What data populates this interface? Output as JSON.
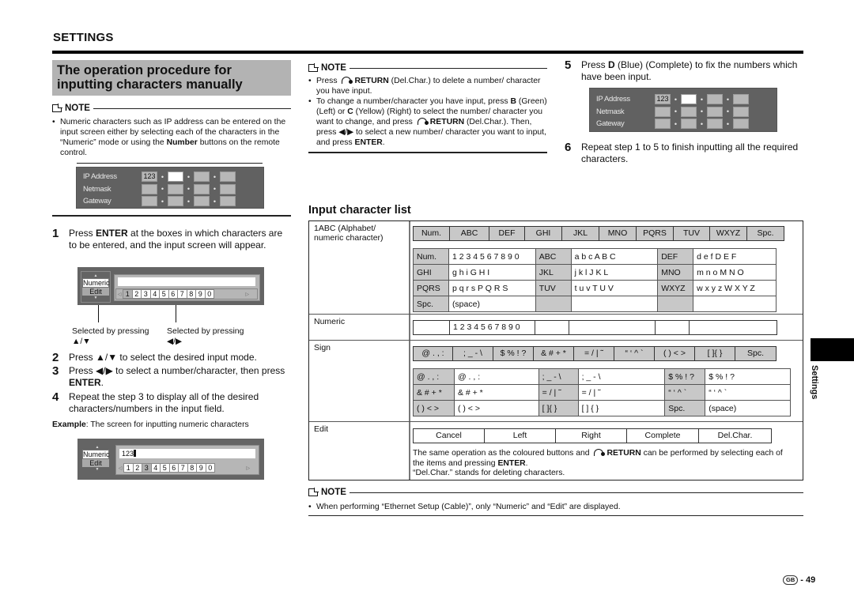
{
  "header": {
    "section": "SETTINGS"
  },
  "procedure": {
    "title_line1": "The operation procedure for",
    "title_line2": "inputting characters manually"
  },
  "note1": {
    "label": "NOTE",
    "text_a": "Numeric characters such as IP address can be entered on the input screen either by selecting each of the characters in the “Numeric” mode or using the ",
    "bold": "Number",
    "text_b": " buttons on the remote control."
  },
  "ip_panel": {
    "rows": [
      {
        "label": "IP Address",
        "first_value": "123"
      },
      {
        "label": "Netmask",
        "first_value": ""
      },
      {
        "label": "Gateway",
        "first_value": ""
      }
    ]
  },
  "step1": {
    "num": "1",
    "pre": "Press ",
    "bold": "ENTER",
    "post": " at the boxes in which characters are to be entered, and the input screen will appear."
  },
  "input_screen": {
    "modes": [
      "Numeric",
      "Edit"
    ],
    "digits": [
      "1",
      "2",
      "3",
      "4",
      "5",
      "6",
      "7",
      "8",
      "9",
      "0"
    ],
    "field_value": "",
    "caption_left": "Selected by pressing",
    "caption_left_keys": "▲/▼",
    "caption_right": "Selected by pressing",
    "caption_right_keys": "◀/▶"
  },
  "step2": {
    "num": "2",
    "text": "Press ▲/▼ to select the desired input mode."
  },
  "step3": {
    "num": "3",
    "pre": "Press ◀/▶ to select a number/character, then press ",
    "bold": "ENTER",
    "post": "."
  },
  "step4": {
    "num": "4",
    "text": "Repeat the step 3 to display all of the desired characters/numbers in the input field."
  },
  "example": {
    "bold": "Example",
    "text": ": The screen for inputting numeric characters",
    "field_value": "123",
    "highlighted_digit": "3"
  },
  "note2": {
    "label": "NOTE",
    "b1_pre": "Press ",
    "b1_return": "RETURN",
    "b1_post": " (Del.Char.) to delete a number/ character you have input.",
    "b2_a": "To change a number/character you have input, press ",
    "b2_B": "B",
    "b2_b": " (Green) (Left) or ",
    "b2_C": "C",
    "b2_c": " (Yellow) (Right) to select the number/ character you want to change, and press ",
    "b2_return": "RETURN",
    "b2_d": " (Del.Char.). Then, press ◀/▶ to select a new number/ character you want to input, and press ",
    "b2_enter": "ENTER",
    "b2_e": "."
  },
  "step5": {
    "num": "5",
    "pre": "Press ",
    "bold": "D",
    "post": " (Blue) (Complete) to fix the numbers which have been input."
  },
  "step6": {
    "num": "6",
    "text": "Repeat step 1 to 5 to finish inputting all the required characters."
  },
  "char_list": {
    "title": "Input character list",
    "alpha": {
      "label": "1ABC (Alphabet/ numeric character)",
      "tabs": [
        "Num.",
        "ABC",
        "DEF",
        "GHI",
        "JKL",
        "MNO",
        "PQRS",
        "TUV",
        "WXYZ",
        "Spc."
      ],
      "rows": [
        [
          [
            "Num.",
            "1 2 3 4 5 6 7 8 9 0"
          ],
          [
            "ABC",
            "a b c A B C"
          ],
          [
            "DEF",
            "d e f D E F"
          ]
        ],
        [
          [
            "GHI",
            "g h i G H I"
          ],
          [
            "JKL",
            "j k l J K L"
          ],
          [
            "MNO",
            "m n o M N O"
          ]
        ],
        [
          [
            "PQRS",
            "p q r s P Q R S"
          ],
          [
            "TUV",
            "t u v T U V"
          ],
          [
            "WXYZ",
            "w x y z W X Y Z"
          ]
        ],
        [
          [
            "Spc.",
            "(space)"
          ],
          [
            "",
            ""
          ],
          [
            "",
            ""
          ]
        ]
      ]
    },
    "numeric": {
      "label": "Numeric",
      "value": "1 2 3 4 5 6 7 8 9 0"
    },
    "sign": {
      "label": "Sign",
      "tabs": [
        "@ . , :",
        "; _ - \\",
        "$ % ! ?",
        "& # + *",
        "= / | ˜",
        "“ ‘ ^ `",
        "( ) < >",
        "[ ]{ }",
        "Spc."
      ],
      "rows": [
        [
          [
            "@ . , :",
            "@  .  ,  :"
          ],
          [
            "; _ - \\",
            ";  _  -  \\"
          ],
          [
            "$ % ! ?",
            "$  %  !  ?"
          ]
        ],
        [
          [
            "& # + *",
            "&  #  +  *"
          ],
          [
            "= / | ˜",
            "=  /  |  ˜"
          ],
          [
            "“ ‘ ^ `",
            "“  ‘  ^  `"
          ]
        ],
        [
          [
            "( ) < >",
            "(  )  <  >"
          ],
          [
            "[  ]{  }",
            "[  ]  {  }"
          ],
          [
            "Spc.",
            "(space)"
          ]
        ]
      ]
    },
    "edit": {
      "label": "Edit",
      "buttons": [
        "Cancel",
        "Left",
        "Right",
        "Complete",
        "Del.Char."
      ],
      "note_a": "The same operation as the coloured buttons and ",
      "note_return": "RETURN",
      "note_b": " can be performed by selecting each of the items and pressing ",
      "note_enter": "ENTER",
      "note_c": ".",
      "note_line3": "“Del.Char.” stands for deleting characters."
    }
  },
  "note3": {
    "label": "NOTE",
    "text": "When performing “Ethernet Setup (Cable)”, only “Numeric” and “Edit” are displayed."
  },
  "side_tab": {
    "label": "Settings"
  },
  "footer": {
    "region": "GB",
    "page": "- 49"
  }
}
